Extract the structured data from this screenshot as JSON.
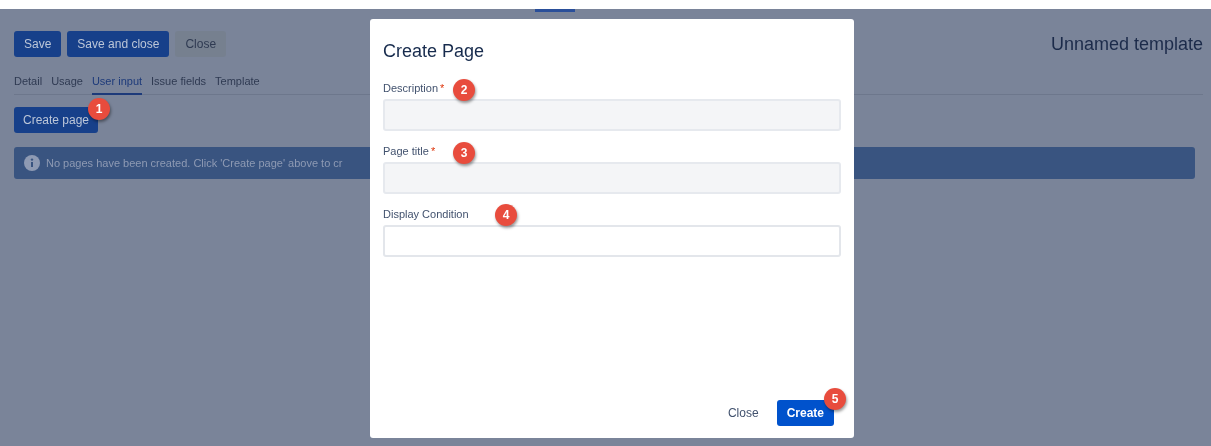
{
  "toolbar": {
    "buttons": [
      {
        "label": "Save",
        "kind": "primary"
      },
      {
        "label": "Save and close",
        "kind": "primary"
      },
      {
        "label": "Close",
        "kind": "subtle"
      }
    ]
  },
  "page_title": "Unnamed template",
  "tabs": [
    {
      "label": "Detail",
      "selected": false
    },
    {
      "label": "Usage",
      "selected": false
    },
    {
      "label": "User input",
      "selected": true
    },
    {
      "label": "Issue fields",
      "selected": false
    },
    {
      "label": "Template",
      "selected": false
    }
  ],
  "create_button": {
    "label": "Create page",
    "step": "1"
  },
  "info_banner": {
    "text": "No pages have been created. Click 'Create page' above to cr"
  },
  "dialog": {
    "title": "Create Page",
    "required_mark": "*",
    "fields": [
      {
        "label": "Description",
        "required": true,
        "step": "2"
      },
      {
        "label": "Page title",
        "required": true,
        "step": "3"
      },
      {
        "label": "Display Condition",
        "required": false,
        "step": "4"
      }
    ],
    "buttons": [
      {
        "label": "Close",
        "kind": "subtle"
      },
      {
        "label": "Create",
        "kind": "primary",
        "step": "5"
      }
    ]
  }
}
